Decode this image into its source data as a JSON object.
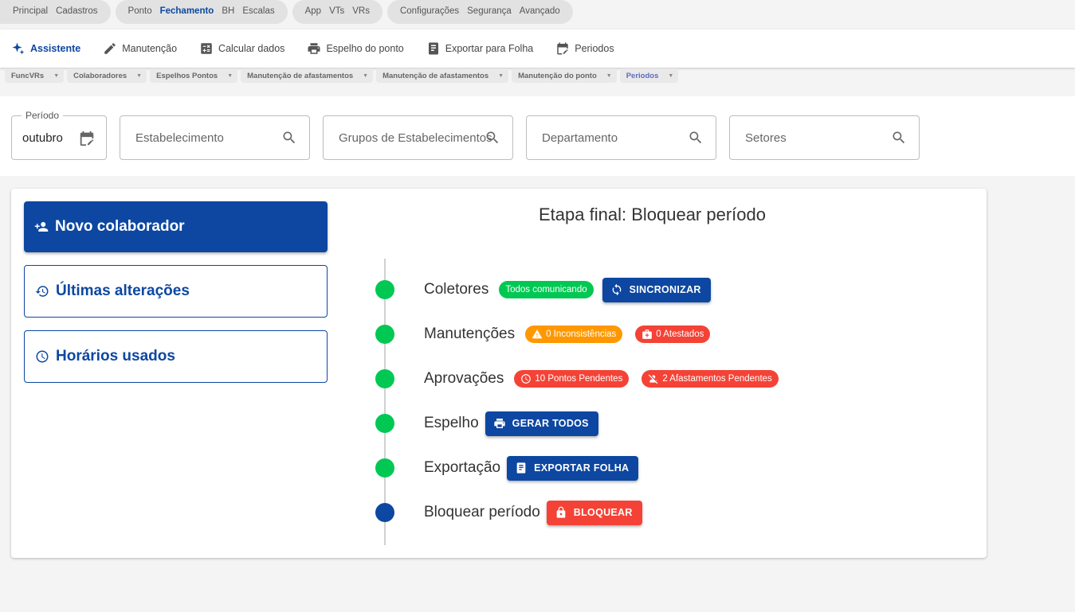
{
  "topnav": [
    {
      "items": [
        {
          "label": "Principal",
          "active": false
        },
        {
          "label": "Cadastros",
          "active": false
        }
      ]
    },
    {
      "items": [
        {
          "label": "Ponto",
          "active": false
        },
        {
          "label": "Fechamento",
          "active": true
        },
        {
          "label": "BH",
          "active": false
        },
        {
          "label": "Escalas",
          "active": false
        }
      ]
    },
    {
      "items": [
        {
          "label": "App",
          "active": false
        },
        {
          "label": "VTs",
          "active": false
        },
        {
          "label": "VRs",
          "active": false
        }
      ]
    },
    {
      "items": [
        {
          "label": "Configurações",
          "active": false
        },
        {
          "label": "Segurança",
          "active": false
        },
        {
          "label": "Avançado",
          "active": false
        }
      ]
    }
  ],
  "toolbar": {
    "assistente": "Assistente",
    "manutencao": "Manutenção",
    "calcular": "Calcular dados",
    "espelho": "Espelho do ponto",
    "exportar": "Exportar para Folha",
    "periodos": "Periodos"
  },
  "tabs": [
    {
      "label": "FuncVRs",
      "active": false
    },
    {
      "label": "Colaboradores",
      "active": false
    },
    {
      "label": "Espelhos Pontos",
      "active": false
    },
    {
      "label": "Manutenção de afastamentos",
      "active": false
    },
    {
      "label": "Manutenção de afastamentos",
      "active": false
    },
    {
      "label": "Manutenção do ponto",
      "active": false
    },
    {
      "label": "Periodos",
      "active": true
    }
  ],
  "filters": {
    "period_label": "Período",
    "period_value": "outubro",
    "estabelecimento": "Estabelecimento",
    "grupos": "Grupos de Estabelecimentos",
    "departamento": "Departamento",
    "setores": "Setores"
  },
  "actions": {
    "novo": "Novo colaborador",
    "ultimas": "Últimas alterações",
    "horarios": "Horários usados"
  },
  "wizard": {
    "title": "Etapa final: Bloquear período",
    "coletores": {
      "label": "Coletores",
      "chip": "Todos comunicando",
      "button": "SINCRONIZAR"
    },
    "manutencoes": {
      "label": "Manutenções",
      "chip1": "0 Inconsistências",
      "chip2": "0 Atestados"
    },
    "aprovacoes": {
      "label": "Aprovações",
      "chip1": "10 Pontos Pendentes",
      "chip2": "2 Afastamentos Pendentes"
    },
    "espelho": {
      "label": "Espelho",
      "button": "GERAR TODOS"
    },
    "exportacao": {
      "label": "Exportação",
      "button": "EXPORTAR FOLHA"
    },
    "bloquear": {
      "label": "Bloquear período",
      "button": "BLOQUEAR"
    }
  },
  "colors": {
    "primary": "#0d47a1",
    "success": "#00c853",
    "warning": "#ff9800",
    "danger": "#f44336"
  }
}
